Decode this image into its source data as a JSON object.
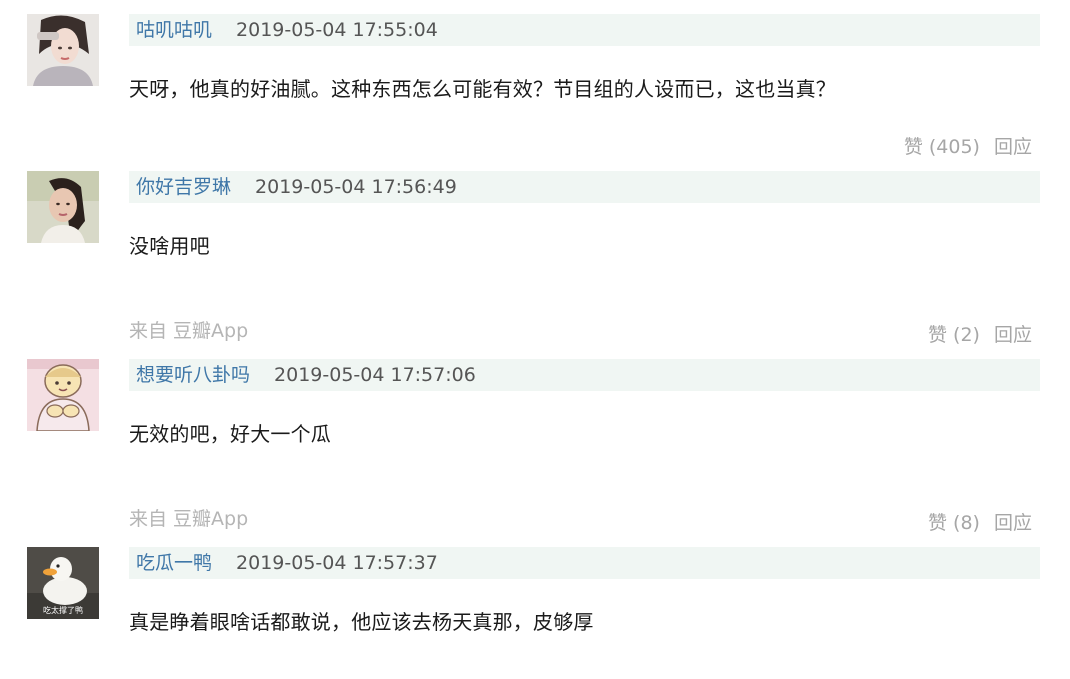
{
  "comments": [
    {
      "username": "咕叽咕叽",
      "time": "2019-05-04 17:55:04",
      "text": "天呀，他真的好油腻。这种东西怎么可能有效？节目组的人设而已，这也当真？",
      "source": "",
      "like_label": "赞 (405)",
      "reply_label": "回应",
      "avatar": "avatar-illustrated-woman"
    },
    {
      "username": "你好吉罗琳",
      "time": "2019-05-04 17:56:49",
      "text": "没啥用吧",
      "source": "来自 豆瓣App",
      "like_label": "赞 (2)",
      "reply_label": "回应",
      "avatar": "avatar-girl-photo"
    },
    {
      "username": "想要听八卦吗",
      "time": "2019-05-04 17:57:06",
      "text": "无效的吧，好大一个瓜",
      "source": "来自 豆瓣App",
      "like_label": "赞 (8)",
      "reply_label": "回应",
      "avatar": "avatar-cartoon-character"
    },
    {
      "username": "吃瓜一鸭",
      "time": "2019-05-04 17:57:37",
      "text": "真是睁着眼啥话都敢说，他应该去杨天真那，皮够厚",
      "source": "",
      "like_label": "",
      "reply_label": "",
      "avatar": "avatar-duck",
      "avatar_caption": "吃太撑了鸭"
    }
  ],
  "colors": {
    "meta_bg": "#f0f6f3",
    "username": "#3f77a8",
    "muted": "#a6a6a6"
  }
}
